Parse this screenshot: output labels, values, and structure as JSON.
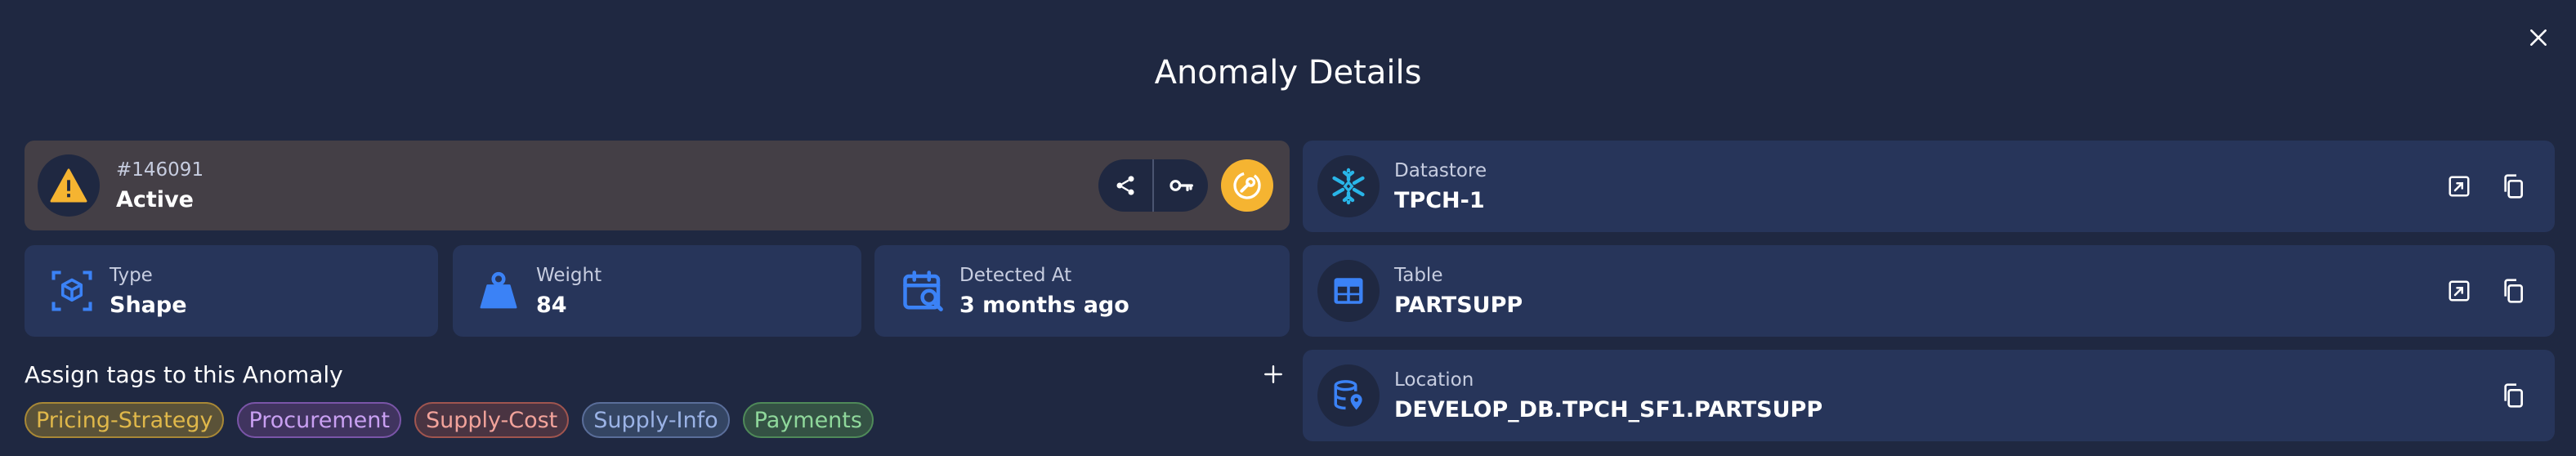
{
  "header": {
    "title": "Anomaly Details"
  },
  "status_card": {
    "id": "#146091",
    "status": "Active"
  },
  "type_card": {
    "label": "Type",
    "value": "Shape"
  },
  "weight_card": {
    "label": "Weight",
    "value": "84"
  },
  "detected_card": {
    "label": "Detected At",
    "value": "3 months ago"
  },
  "datastore_card": {
    "label": "Datastore",
    "value": "TPCH-1"
  },
  "table_card": {
    "label": "Table",
    "value": "PARTSUPP"
  },
  "location_card": {
    "label": "Location",
    "value": "DEVELOP_DB.TPCH_SF1.PARTSUPP"
  },
  "tags": {
    "title": "Assign tags to this Anomaly",
    "items": [
      {
        "label": "Pricing-Strategy",
        "color": "#e0b84a"
      },
      {
        "label": "Procurement",
        "color": "#c9a0f2"
      },
      {
        "label": "Supply-Cost",
        "color": "#f2a39b"
      },
      {
        "label": "Supply-Info",
        "color": "#9bb3e6"
      },
      {
        "label": "Payments",
        "color": "#8fd89b"
      }
    ]
  },
  "colors": {
    "background": "#1f2841",
    "card": "#27355a",
    "status_card": "#443f46",
    "warning": "#f5b431",
    "accent_blue": "#3b82f6",
    "snowflake": "#29b5e8"
  }
}
